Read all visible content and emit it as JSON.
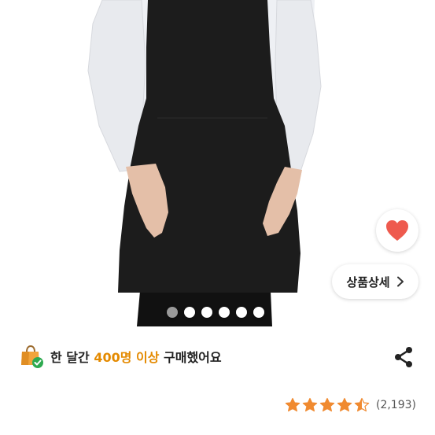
{
  "product": {
    "image": {
      "description": "black apron worn over white shirt",
      "total_images": 6,
      "active_index": 0
    },
    "like": {
      "icon": "heart-icon",
      "active": true,
      "color": "#ee5a4e"
    },
    "detail_button": {
      "label": "상품상세",
      "icon": "chevron-right-icon"
    },
    "purchase_info": {
      "icon": "shopping-bag-check-icon",
      "prefix": "한 달간 ",
      "highlight": "400명 이상",
      "suffix": " 구매했어요",
      "highlight_color": "#e48a00"
    },
    "share": {
      "icon": "share-icon"
    },
    "rating": {
      "stars": 4.5,
      "count_text": "(2,193)",
      "star_color": "#f08a30"
    }
  }
}
